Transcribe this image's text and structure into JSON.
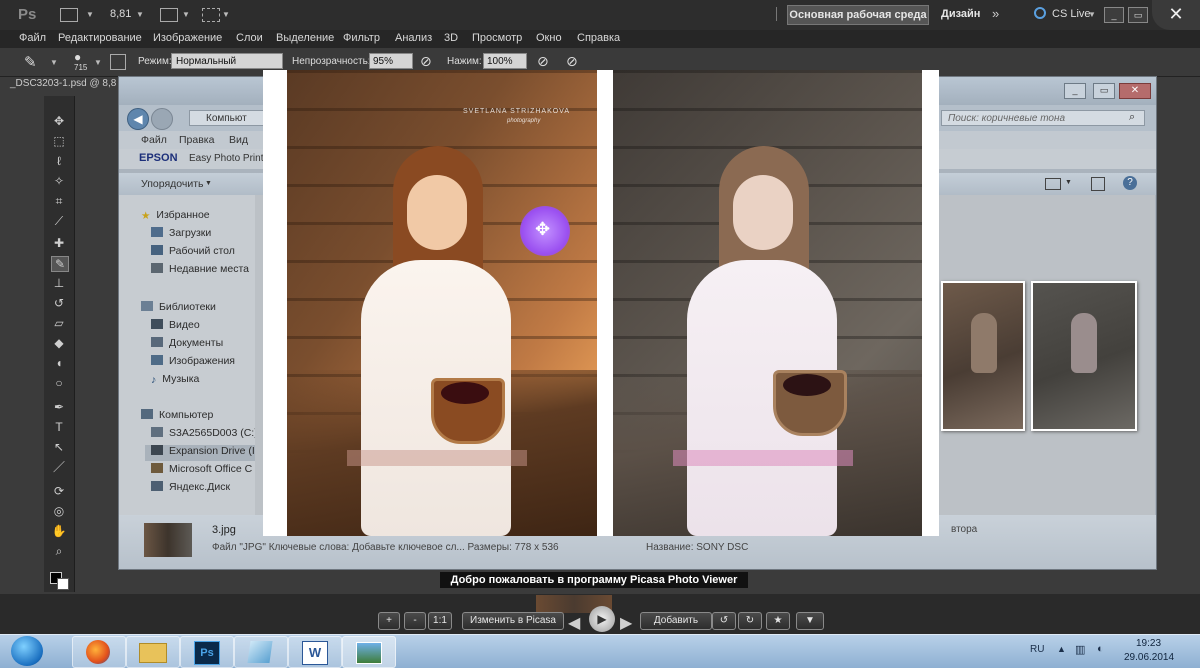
{
  "photoshop": {
    "logo": "Ps",
    "zoom": "8,81",
    "workspace_button": "Основная рабочая среда",
    "design_label": "Дизайн",
    "cslive_label": "CS Live",
    "menu": [
      "Файл",
      "Редактирование",
      "Изображение",
      "Слои",
      "Выделение",
      "Фильтр",
      "Анализ",
      "3D",
      "Просмотр",
      "Окно",
      "Справка"
    ],
    "options": {
      "brush_size": "715",
      "mode_label": "Режим:",
      "mode_value": "Нормальный",
      "opacity_label": "Непрозрачность:",
      "opacity_value": "95%",
      "pressure_label": "Нажим:",
      "pressure_value": "100%"
    },
    "doc_tab": "_DSC3203-1.psd @ 8,8",
    "tools": [
      "move-icon",
      "marquee-icon",
      "lasso-icon",
      "quick-select-icon",
      "crop-icon",
      "eyedropper-icon",
      "healing-icon",
      "brush-icon",
      "stamp-icon",
      "history-brush-icon",
      "eraser-icon",
      "bucket-icon",
      "blur-icon",
      "dodge-icon",
      "pen-icon",
      "text-icon",
      "path-select-icon",
      "line-icon",
      "3d-rotate-icon",
      "3d-orbit-icon",
      "hand-icon",
      "zoom-icon"
    ]
  },
  "explorer": {
    "address": "Компьют",
    "search_placeholder": "Поиск: коричневые тона",
    "menu": [
      "Файл",
      "Правка",
      "Вид"
    ],
    "epson_brand": "EPSON",
    "epson_app": "Easy Photo Print",
    "organize": "Упорядочить",
    "nav": {
      "favorites": "Избранное",
      "downloads": "Загрузки",
      "desktop": "Рабочий стол",
      "recent": "Недавние места",
      "libraries": "Библиотеки",
      "video": "Видео",
      "documents": "Документы",
      "images": "Изображения",
      "music": "Музыка",
      "computer": "Компьютер",
      "drive_c": "S3A2565D003 (C:)",
      "expansion": "Expansion Drive (I",
      "office": "Microsoft Office C",
      "yandex": "Яндекс.Диск"
    },
    "details": {
      "filename": "3.jpg",
      "file_info": "Файл \"JPG\"  Ключевые слова: Добавьте ключевое сл...  Размеры: 778 x 536",
      "title_info": "Название:  SONY DSC",
      "author_fragment": "втора"
    }
  },
  "photo": {
    "watermark_name": "SVETLANA STRIZHAKOVA",
    "watermark_sub": "photography"
  },
  "picasa": {
    "welcome": "Добро пожаловать в программу Picasa Photo Viewer",
    "plus": "+",
    "minus": "-",
    "one_to_one": "1:1",
    "edit": "Изменить в Picasa",
    "add": "Добавить"
  },
  "taskbar": {
    "lang": "RU",
    "time": "19:23",
    "date": "29.06.2014",
    "ps_label": "Ps",
    "word_label": "W"
  },
  "colors": {
    "ps_dark": "#2d2d2d",
    "cursor_purple": "#a050f0",
    "taskbar_blue": "#9cbcde"
  }
}
